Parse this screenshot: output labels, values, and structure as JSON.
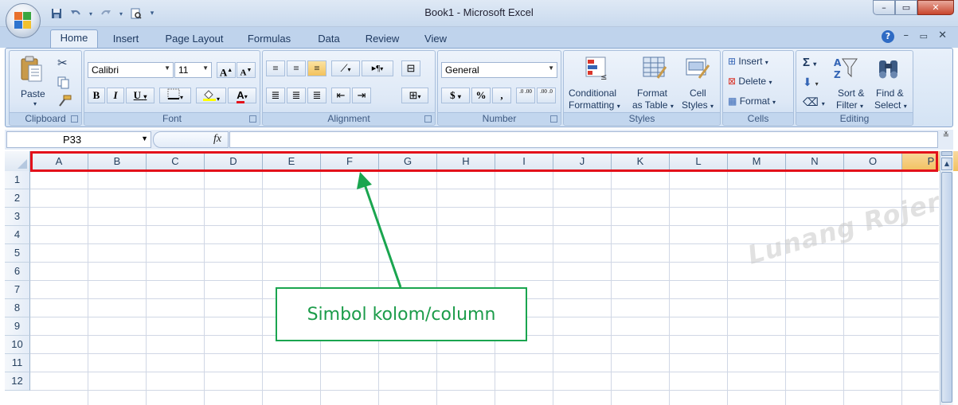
{
  "window": {
    "title": "Book1 - Microsoft Excel",
    "minimize": "–",
    "restore": "▭",
    "close": "✕"
  },
  "qat": {
    "save_icon": "save-icon",
    "undo_icon": "undo-icon",
    "redo_icon": "redo-icon",
    "print_preview_icon": "print-preview-icon"
  },
  "tabs": [
    {
      "label": "Home",
      "active": true
    },
    {
      "label": "Insert"
    },
    {
      "label": "Page Layout"
    },
    {
      "label": "Formulas"
    },
    {
      "label": "Data"
    },
    {
      "label": "Review"
    },
    {
      "label": "View"
    }
  ],
  "ribbon": {
    "clipboard": {
      "label": "Clipboard",
      "paste": "Paste"
    },
    "font": {
      "label": "Font",
      "name": "Calibri",
      "size": "11",
      "bold": "B",
      "italic": "I",
      "underline": "U",
      "grow": "A",
      "shrink": "A"
    },
    "alignment": {
      "label": "Alignment"
    },
    "number": {
      "label": "Number",
      "format": "General",
      "currency": "$",
      "percent": "%",
      "comma": ",",
      "inc_dec": ".0 .00",
      "dec_dec": ".00 .0"
    },
    "styles": {
      "label": "Styles",
      "conditional_1": "Conditional",
      "conditional_2": "Formatting",
      "format_table_1": "Format",
      "format_table_2": "as Table",
      "cell_styles_1": "Cell",
      "cell_styles_2": "Styles"
    },
    "cells": {
      "label": "Cells",
      "insert": "Insert",
      "delete": "Delete",
      "format": "Format"
    },
    "editing": {
      "label": "Editing",
      "sort_1": "Sort &",
      "sort_2": "Filter",
      "find_1": "Find &",
      "find_2": "Select"
    }
  },
  "formula_bar": {
    "name_box": "P33",
    "fx": "fx",
    "value": ""
  },
  "columns": [
    "A",
    "B",
    "C",
    "D",
    "E",
    "F",
    "G",
    "H",
    "I",
    "J",
    "K",
    "L",
    "M",
    "N",
    "O",
    "P"
  ],
  "selected_column": "P",
  "rows": [
    "1",
    "2",
    "3",
    "4",
    "5",
    "6",
    "7",
    "8",
    "9",
    "10",
    "11",
    "12"
  ],
  "annotation": {
    "text": "Simbol kolom/column",
    "color": "#1c9c4a"
  },
  "highlight_color": "#e3111a",
  "watermark": "Lunang Rojer"
}
